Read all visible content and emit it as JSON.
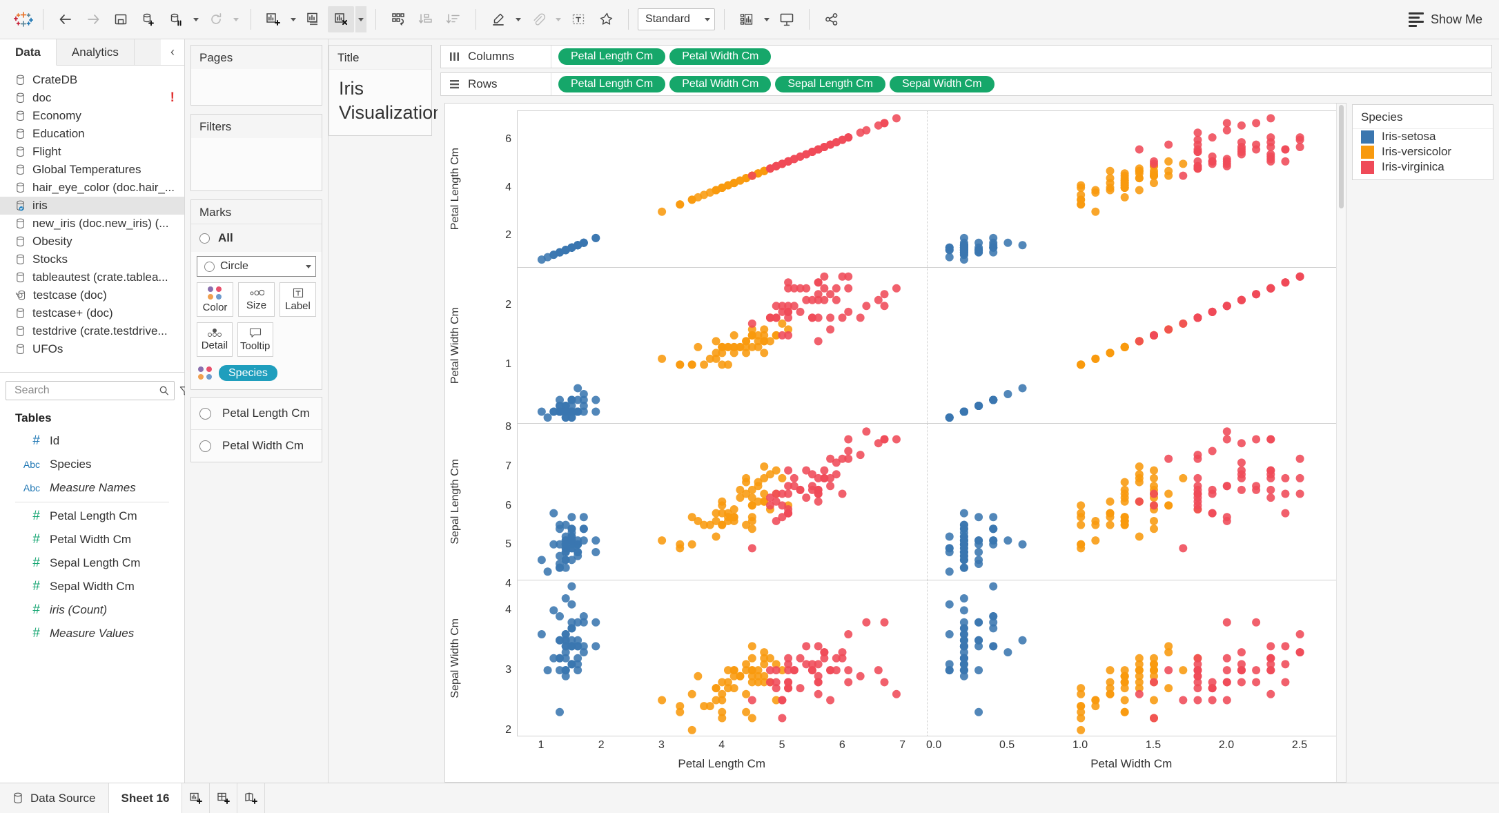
{
  "app": {
    "fit_mode": "Standard",
    "show_me": "Show Me"
  },
  "left_pane": {
    "tabs": [
      {
        "label": "Data",
        "active": true
      },
      {
        "label": "Analytics",
        "active": false
      }
    ],
    "data_sources": [
      {
        "label": "CrateDB",
        "icon": "database-icon",
        "selected": false,
        "warning": false
      },
      {
        "label": "doc",
        "icon": "database-icon",
        "selected": false,
        "warning": true
      },
      {
        "label": "Economy",
        "icon": "database-icon",
        "selected": false,
        "warning": false
      },
      {
        "label": "Education",
        "icon": "database-icon",
        "selected": false,
        "warning": false
      },
      {
        "label": "Flight",
        "icon": "database-icon",
        "selected": false,
        "warning": false
      },
      {
        "label": "Global Temperatures",
        "icon": "database-icon",
        "selected": false,
        "warning": false
      },
      {
        "label": "hair_eye_color (doc.hair_...",
        "icon": "database-icon",
        "selected": false,
        "warning": false
      },
      {
        "label": "iris",
        "icon": "database-connected-icon",
        "selected": true,
        "warning": false
      },
      {
        "label": "new_iris (doc.new_iris) (...",
        "icon": "database-icon",
        "selected": false,
        "warning": false
      },
      {
        "label": "Obesity",
        "icon": "database-icon",
        "selected": false,
        "warning": false
      },
      {
        "label": "Stocks",
        "icon": "database-icon",
        "selected": false,
        "warning": false
      },
      {
        "label": "tableautest (crate.tablea...",
        "icon": "database-icon",
        "selected": false,
        "warning": false
      },
      {
        "label": "testcase (doc)",
        "icon": "database-refresh-icon",
        "selected": false,
        "warning": false
      },
      {
        "label": "testcase+ (doc)",
        "icon": "database-icon",
        "selected": false,
        "warning": false
      },
      {
        "label": "testdrive (crate.testdrive...",
        "icon": "database-icon",
        "selected": false,
        "warning": false
      },
      {
        "label": "UFOs",
        "icon": "database-icon",
        "selected": false,
        "warning": false
      }
    ],
    "search": {
      "value": "",
      "placeholder": "Search"
    },
    "tables_header": "Tables",
    "fields": [
      {
        "label": "Id",
        "type": "#",
        "color": "blue",
        "italic": false,
        "divider_after": false
      },
      {
        "label": "Species",
        "type": "Abc",
        "color": "blue",
        "italic": false,
        "divider_after": false
      },
      {
        "label": "Measure Names",
        "type": "Abc",
        "color": "blue",
        "italic": true,
        "divider_after": true
      },
      {
        "label": "Petal Length Cm",
        "type": "#",
        "color": "green",
        "italic": false,
        "divider_after": false
      },
      {
        "label": "Petal Width Cm",
        "type": "#",
        "color": "green",
        "italic": false,
        "divider_after": false
      },
      {
        "label": "Sepal Length Cm",
        "type": "#",
        "color": "green",
        "italic": false,
        "divider_after": false
      },
      {
        "label": "Sepal Width Cm",
        "type": "#",
        "color": "green",
        "italic": false,
        "divider_after": false
      },
      {
        "label": "iris (Count)",
        "type": "#",
        "color": "green",
        "italic": true,
        "divider_after": false
      },
      {
        "label": "Measure Values",
        "type": "#",
        "color": "green",
        "italic": true,
        "divider_after": false
      }
    ]
  },
  "cards": {
    "pages_title": "Pages",
    "filters_title": "Filters",
    "marks_title": "Marks",
    "marks_all_label": "All",
    "mark_type": "Circle",
    "buttons": [
      {
        "label": "Color",
        "icon": "color-dots-icon"
      },
      {
        "label": "Size",
        "icon": "size-icon"
      },
      {
        "label": "Label",
        "icon": "label-icon"
      },
      {
        "label": "Detail",
        "icon": "detail-dots-icon"
      },
      {
        "label": "Tooltip",
        "icon": "tooltip-icon"
      }
    ],
    "color_pill": "Species",
    "lower_shelf": [
      {
        "label": "Petal Length Cm"
      },
      {
        "label": "Petal Width Cm"
      }
    ]
  },
  "title_card": {
    "header": "Title",
    "text": "Iris Visualization"
  },
  "shelves": {
    "columns_label": "Columns",
    "rows_label": "Rows",
    "columns_pills": [
      "Petal Length Cm",
      "Petal Width Cm"
    ],
    "rows_pills": [
      "Petal Length Cm",
      "Petal Width Cm",
      "Sepal Length Cm",
      "Sepal Width Cm"
    ]
  },
  "legend": {
    "title": "Species",
    "items": [
      {
        "label": "Iris-setosa",
        "color": "#3a76af"
      },
      {
        "label": "Iris-versicolor",
        "color": "#f89a0e"
      },
      {
        "label": "Iris-virginica",
        "color": "#ef4a58"
      }
    ]
  },
  "status_bar": {
    "data_source": "Data Source",
    "sheet": "Sheet 16",
    "icons": [
      "new-worksheet-icon",
      "new-dashboard-icon",
      "new-story-icon"
    ]
  },
  "chart_data": {
    "type": "scatter",
    "title": "Iris Visualization",
    "description": "Scatter plot matrix: 4 measure rows x 2 measure columns, colored by Species",
    "legend_position": "right",
    "grid": false,
    "series": [
      {
        "name": "Iris-setosa",
        "color": "#3a76af"
      },
      {
        "name": "Iris-versicolor",
        "color": "#f89a0e"
      },
      {
        "name": "Iris-virginica",
        "color": "#ef4a58"
      }
    ],
    "columns": [
      {
        "field": "Petal Length Cm",
        "ticks": [
          1,
          2,
          3,
          4,
          5,
          6,
          7
        ],
        "xlim": [
          0.6,
          7.4
        ]
      },
      {
        "field": "Petal Width Cm",
        "ticks": [
          "0.0",
          "0.5",
          "1.0",
          "1.5",
          "2.0",
          "2.5"
        ],
        "xlim": [
          -0.05,
          2.75
        ]
      }
    ],
    "rows": [
      {
        "field": "Petal Length Cm",
        "ticks": [
          2,
          4,
          6
        ],
        "ylim": [
          0.7,
          7.2
        ]
      },
      {
        "field": "Petal Width Cm",
        "ticks": [
          1,
          2
        ],
        "ylim": [
          0.0,
          2.65
        ]
      },
      {
        "field": "Sepal Length Cm",
        "ticks": [
          4,
          5,
          6,
          7,
          8
        ],
        "ylim": [
          4.1,
          8.1
        ]
      },
      {
        "field": "Sepal Width Cm",
        "ticks": [
          2,
          3,
          4
        ],
        "ylim": [
          1.9,
          4.5
        ]
      }
    ],
    "points": {
      "petal_length": [
        1.4,
        1.4,
        1.3,
        1.5,
        1.4,
        1.7,
        1.4,
        1.5,
        1.4,
        1.5,
        1.5,
        1.6,
        1.4,
        1.1,
        1.2,
        1.5,
        1.3,
        1.4,
        1.7,
        1.5,
        1.7,
        1.5,
        1.0,
        1.7,
        1.9,
        1.6,
        1.6,
        1.5,
        1.4,
        1.6,
        1.6,
        1.5,
        1.5,
        1.4,
        1.5,
        1.2,
        1.3,
        1.4,
        1.3,
        1.5,
        1.3,
        1.3,
        1.3,
        1.6,
        1.9,
        1.4,
        1.6,
        1.4,
        1.5,
        1.4,
        4.7,
        4.5,
        4.9,
        4.0,
        4.6,
        4.5,
        4.7,
        3.3,
        4.6,
        3.9,
        3.5,
        4.2,
        4.0,
        4.7,
        3.6,
        4.4,
        4.5,
        4.1,
        4.5,
        3.9,
        4.8,
        4.0,
        4.9,
        4.7,
        4.3,
        4.4,
        4.8,
        5.0,
        4.5,
        3.5,
        3.8,
        3.7,
        3.9,
        5.1,
        4.5,
        4.5,
        4.7,
        4.4,
        4.1,
        4.0,
        4.4,
        4.6,
        4.0,
        3.3,
        4.2,
        4.2,
        4.2,
        4.3,
        3.0,
        4.1,
        6.0,
        5.1,
        5.9,
        5.6,
        5.8,
        6.6,
        4.5,
        6.3,
        5.8,
        6.1,
        5.1,
        5.3,
        5.5,
        5.0,
        5.1,
        5.3,
        5.5,
        6.7,
        6.9,
        5.0,
        5.7,
        4.9,
        6.7,
        4.9,
        5.7,
        6.0,
        4.8,
        4.9,
        5.6,
        5.8,
        6.1,
        6.4,
        5.6,
        5.1,
        5.6,
        6.1,
        5.6,
        5.5,
        4.8,
        5.4,
        5.6,
        5.1,
        5.1,
        5.9,
        5.7,
        5.2,
        5.0,
        5.2,
        5.4,
        5.1
      ],
      "petal_width": [
        0.2,
        0.2,
        0.2,
        0.2,
        0.2,
        0.4,
        0.3,
        0.2,
        0.2,
        0.1,
        0.2,
        0.2,
        0.1,
        0.1,
        0.2,
        0.4,
        0.4,
        0.3,
        0.3,
        0.3,
        0.2,
        0.4,
        0.2,
        0.5,
        0.2,
        0.2,
        0.4,
        0.2,
        0.2,
        0.2,
        0.2,
        0.4,
        0.1,
        0.2,
        0.2,
        0.2,
        0.2,
        0.1,
        0.2,
        0.2,
        0.3,
        0.3,
        0.2,
        0.6,
        0.4,
        0.3,
        0.2,
        0.2,
        0.2,
        0.2,
        1.4,
        1.5,
        1.5,
        1.3,
        1.5,
        1.3,
        1.6,
        1.0,
        1.3,
        1.4,
        1.0,
        1.5,
        1.0,
        1.4,
        1.3,
        1.4,
        1.5,
        1.0,
        1.5,
        1.1,
        1.8,
        1.3,
        1.5,
        1.2,
        1.3,
        1.4,
        1.4,
        1.7,
        1.5,
        1.0,
        1.1,
        1.0,
        1.2,
        1.6,
        1.5,
        1.6,
        1.5,
        1.3,
        1.3,
        1.3,
        1.2,
        1.4,
        1.2,
        1.0,
        1.3,
        1.2,
        1.3,
        1.3,
        1.1,
        1.3,
        2.5,
        1.9,
        2.1,
        1.8,
        2.2,
        2.1,
        1.7,
        1.8,
        1.8,
        2.5,
        2.0,
        1.9,
        2.1,
        2.0,
        2.4,
        2.3,
        1.8,
        2.2,
        2.3,
        1.5,
        2.3,
        2.0,
        2.0,
        1.8,
        2.1,
        1.8,
        1.8,
        1.8,
        2.1,
        1.6,
        1.9,
        2.0,
        2.2,
        1.5,
        1.4,
        2.3,
        2.4,
        1.8,
        1.8,
        2.1,
        2.4,
        2.3,
        1.9,
        2.3,
        2.5,
        2.3,
        1.9,
        2.0,
        2.3,
        1.8
      ],
      "sepal_length": [
        5.1,
        4.9,
        4.7,
        4.6,
        5.0,
        5.4,
        4.6,
        5.0,
        4.4,
        4.9,
        5.4,
        4.8,
        4.8,
        4.3,
        5.8,
        5.7,
        5.4,
        5.1,
        5.7,
        5.1,
        5.4,
        5.1,
        4.6,
        5.1,
        4.8,
        5.0,
        5.0,
        5.2,
        5.2,
        4.7,
        4.8,
        5.4,
        5.2,
        5.5,
        4.9,
        5.0,
        5.5,
        4.9,
        4.4,
        5.1,
        5.0,
        4.5,
        4.4,
        5.0,
        5.1,
        4.8,
        5.1,
        4.6,
        5.3,
        5.0,
        7.0,
        6.4,
        6.9,
        5.5,
        6.5,
        5.7,
        6.3,
        4.9,
        6.6,
        5.2,
        5.0,
        5.9,
        6.0,
        6.1,
        5.6,
        6.7,
        5.6,
        5.8,
        6.2,
        5.6,
        5.9,
        6.1,
        6.3,
        6.1,
        6.4,
        6.6,
        6.8,
        6.7,
        6.0,
        5.7,
        5.5,
        5.5,
        5.8,
        6.0,
        5.4,
        6.0,
        6.7,
        6.3,
        5.6,
        5.5,
        5.5,
        6.1,
        5.8,
        5.0,
        5.6,
        5.7,
        5.7,
        6.2,
        5.1,
        5.7,
        6.3,
        5.8,
        7.1,
        6.3,
        6.5,
        7.6,
        4.9,
        7.3,
        6.7,
        7.2,
        6.5,
        6.4,
        6.8,
        5.7,
        5.8,
        6.4,
        6.5,
        7.7,
        7.7,
        6.0,
        6.9,
        5.6,
        7.7,
        6.3,
        6.7,
        7.2,
        6.2,
        6.1,
        6.4,
        7.2,
        7.4,
        7.9,
        6.4,
        6.3,
        6.1,
        7.7,
        6.3,
        6.4,
        6.0,
        6.9,
        6.7,
        6.9,
        5.8,
        6.8,
        6.7,
        6.7,
        6.3,
        6.5,
        6.2,
        5.9
      ],
      "sepal_width": [
        3.5,
        3.0,
        3.2,
        3.1,
        3.6,
        3.9,
        3.4,
        3.4,
        2.9,
        3.1,
        3.7,
        3.4,
        3.0,
        3.0,
        4.0,
        4.4,
        3.9,
        3.5,
        3.8,
        3.8,
        3.4,
        3.7,
        3.6,
        3.3,
        3.4,
        3.0,
        3.4,
        3.5,
        3.4,
        3.2,
        3.1,
        3.4,
        4.1,
        4.2,
        3.1,
        3.2,
        3.5,
        3.6,
        3.0,
        3.4,
        3.5,
        2.3,
        3.2,
        3.5,
        3.8,
        3.0,
        3.8,
        3.2,
        3.7,
        3.3,
        3.2,
        3.2,
        3.1,
        2.3,
        2.8,
        2.8,
        3.3,
        2.4,
        2.9,
        2.7,
        2.0,
        3.0,
        2.2,
        2.9,
        2.9,
        3.1,
        3.0,
        2.7,
        2.2,
        2.5,
        3.2,
        2.8,
        2.5,
        2.8,
        2.9,
        3.0,
        2.8,
        3.0,
        2.9,
        2.6,
        2.4,
        2.4,
        2.7,
        2.7,
        3.0,
        3.4,
        3.1,
        2.3,
        3.0,
        2.5,
        2.6,
        3.0,
        2.6,
        2.3,
        2.7,
        3.0,
        2.9,
        2.9,
        2.5,
        2.8,
        3.3,
        2.7,
        3.0,
        2.9,
        3.0,
        3.0,
        2.5,
        2.9,
        2.5,
        3.6,
        3.2,
        2.7,
        3.0,
        2.5,
        2.8,
        3.2,
        3.0,
        3.8,
        2.6,
        2.2,
        3.2,
        2.8,
        2.8,
        2.7,
        3.3,
        3.2,
        2.8,
        3.0,
        2.8,
        3.0,
        2.8,
        3.8,
        2.8,
        2.8,
        2.6,
        3.0,
        3.4,
        3.1,
        3.0,
        3.1,
        3.1,
        3.1,
        2.7,
        3.2,
        3.3,
        3.0,
        2.5,
        3.0,
        3.4,
        3.0
      ],
      "species": [
        "Iris-setosa",
        "Iris-versicolor",
        "Iris-virginica"
      ],
      "species_counts": [
        50,
        50,
        50
      ]
    }
  }
}
